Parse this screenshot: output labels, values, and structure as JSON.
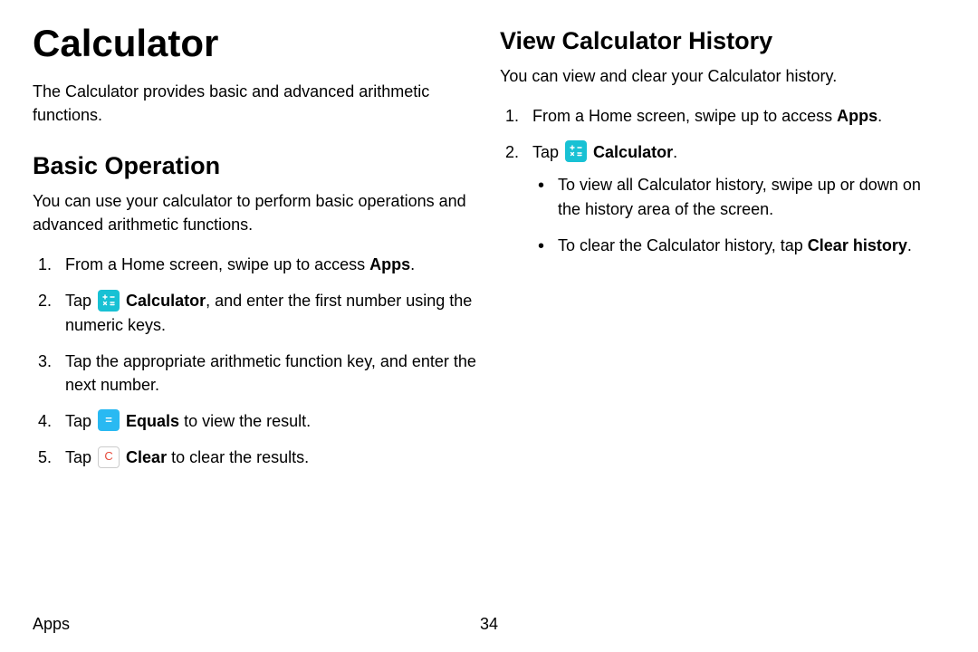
{
  "left": {
    "pageTitle": "Calculator",
    "intro": "The Calculator provides basic and advanced arithmetic functions.",
    "basicOp": {
      "heading": "Basic Operation",
      "intro": "You can use your calculator to perform basic operations and advanced arithmetic functions.",
      "steps": {
        "s1_a": "From a Home screen, swipe up to access ",
        "s1_b": "Apps",
        "s1_c": ".",
        "s2_a": "Tap ",
        "s2_b": "Calculator",
        "s2_c": ", and enter the first number using the numeric keys.",
        "s3": "Tap the appropriate arithmetic function key, and enter the next number.",
        "s4_a": "Tap ",
        "s4_b": "Equals",
        "s4_c": " to view the result.",
        "s5_a": "Tap ",
        "s5_b": "Clear",
        "s5_c": " to clear the results."
      }
    }
  },
  "right": {
    "heading": "View Calculator History",
    "intro": "You can view and clear your Calculator history.",
    "steps": {
      "s1_a": "From a Home screen, swipe up to access ",
      "s1_b": "Apps",
      "s1_c": ".",
      "s2_a": "Tap ",
      "s2_b": "Calculator",
      "s2_c": "."
    },
    "bullets": {
      "b1": "To view all Calculator history, swipe up or down on the history area of the screen.",
      "b2_a": "To clear the Calculator history, tap ",
      "b2_b": "Clear history",
      "b2_c": "."
    }
  },
  "icons": {
    "equals": "=",
    "clearC": "C"
  },
  "footer": {
    "section": "Apps",
    "page": "34"
  }
}
